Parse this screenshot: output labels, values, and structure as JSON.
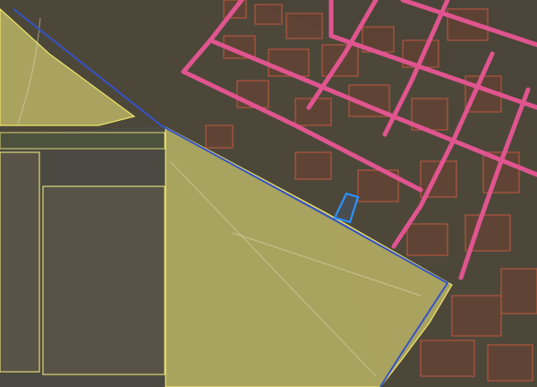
{
  "map": {
    "layers": [
      "satellite-imagery",
      "field-polygons",
      "parcel-polygons",
      "road-lines",
      "selected-parcel"
    ],
    "colors": {
      "field_fill": "#d4cf73",
      "field_outline": "#efe56a",
      "parcel_outline": "#c2583f",
      "road": "#e0558f",
      "boundary": "#3453c8",
      "selection": "#2a92ff"
    }
  }
}
